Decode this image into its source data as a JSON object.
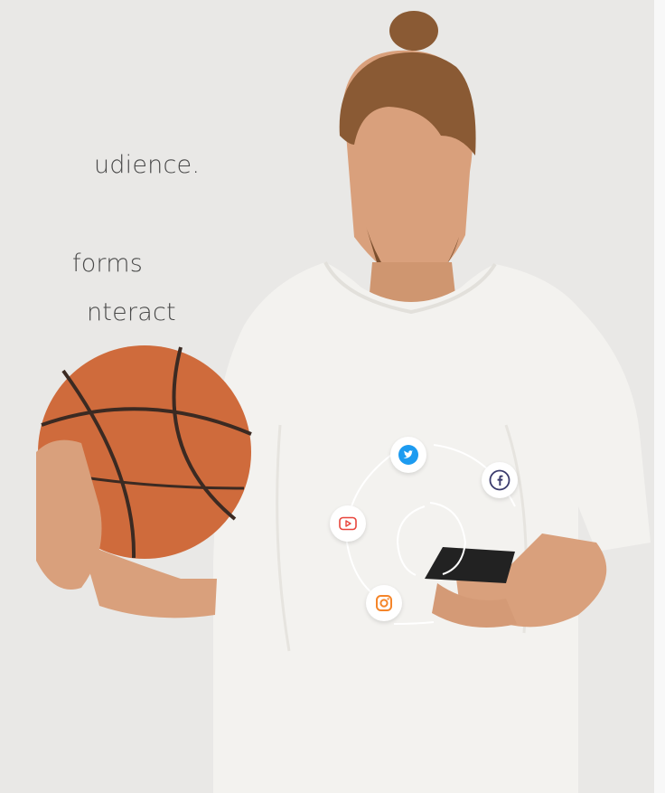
{
  "copy": {
    "line_1": "udience.",
    "line_2": "forms",
    "line_3": "nteract"
  },
  "social_icons": {
    "twitter": {
      "icon": "twitter-bird-icon",
      "color": "#1d9bf0"
    },
    "facebook": {
      "icon": "facebook-f-icon",
      "color": "#3b3b6d"
    },
    "youtube": {
      "icon": "youtube-play-icon",
      "color": "#e8453c"
    },
    "instagram": {
      "icon": "instagram-camera-icon",
      "color": "#f58529"
    }
  },
  "colors": {
    "background": "#e9e8e6",
    "text": "#4a4a4a",
    "basketball": "#cf6b3c",
    "shirt": "#f3f2ef",
    "skin": "#d9a07c",
    "hair": "#8a5a34"
  }
}
